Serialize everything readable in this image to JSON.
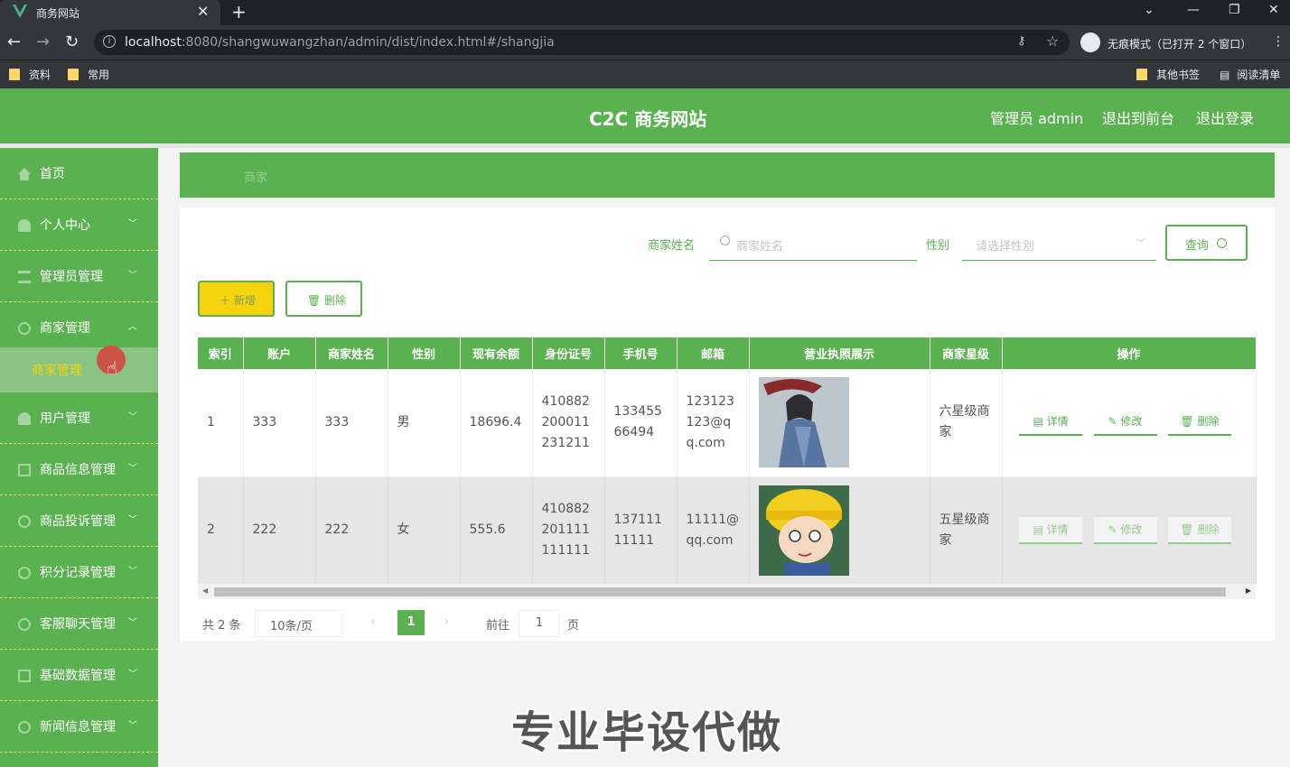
{
  "browser": {
    "tab_title": "商务网站",
    "tab_close": "✕",
    "new_tab": "+",
    "url_host": "localhost",
    "url_rest": ":8080/shangwuwangzhan/admin/dist/index.html#/shangjia",
    "incognito_label": "无痕模式（已打开 2 个窗口）",
    "bookmarks": [
      "资料",
      "常用"
    ],
    "other_bookmarks": "其他书签",
    "reading_list": "阅读清单"
  },
  "header": {
    "brand": "C2C 商务网站",
    "admin_label": "管理员 admin",
    "to_front": "退出到前台",
    "logout": "退出登录"
  },
  "sidebar": {
    "items": [
      {
        "label": "首页",
        "icon": "home-icon",
        "expandable": false
      },
      {
        "label": "个人中心",
        "icon": "user-icon",
        "expandable": true
      },
      {
        "label": "管理员管理",
        "icon": "menu-icon",
        "expandable": true
      },
      {
        "label": "商家管理",
        "icon": "store-icon",
        "expandable": true,
        "expanded": true
      },
      {
        "label": "用户管理",
        "icon": "users-icon",
        "expandable": true
      },
      {
        "label": "商品信息管理",
        "icon": "grid-icon",
        "expandable": true
      },
      {
        "label": "商品投诉管理",
        "icon": "complaint-icon",
        "expandable": true
      },
      {
        "label": "积分记录管理",
        "icon": "points-icon",
        "expandable": true
      },
      {
        "label": "客服聊天管理",
        "icon": "chat-icon",
        "expandable": true
      },
      {
        "label": "基础数据管理",
        "icon": "data-icon",
        "expandable": true
      },
      {
        "label": "新闻信息管理",
        "icon": "news-icon",
        "expandable": true
      }
    ],
    "active_sub": "商家管理"
  },
  "breadcrumb": "商家",
  "search": {
    "name_label": "商家姓名",
    "name_placeholder": "商家姓名",
    "gender_label": "性别",
    "gender_placeholder": "请选择性别",
    "query_button": "查询"
  },
  "actions": {
    "add": "＋ 新增",
    "delete": "🗑 删除"
  },
  "table": {
    "columns": [
      "索引",
      "账户",
      "商家姓名",
      "性别",
      "现有余额",
      "身份证号",
      "手机号",
      "邮箱",
      "营业执照展示",
      "商家星级",
      "操作"
    ],
    "rows": [
      {
        "index": "1",
        "account": "333",
        "name": "333",
        "gender": "男",
        "balance": "18696.4",
        "id_card": "410882200011231211",
        "phone": "13345566494",
        "email": "123123123@qq.com",
        "star": "六星级商家"
      },
      {
        "index": "2",
        "account": "222",
        "name": "222",
        "gender": "女",
        "balance": "555.6",
        "id_card": "410882201111111111",
        "phone": "13711111111",
        "email": "11111@qq.com",
        "star": "五星级商家"
      }
    ],
    "op_detail": "详情",
    "op_edit": "修改",
    "op_delete": "删除"
  },
  "pagination": {
    "total": "共 2 条",
    "page_size": "10条/页",
    "current": "1",
    "goto_label": "前往",
    "goto_value": "1",
    "page_suffix": "页"
  },
  "watermark": "专业毕设代做",
  "colors": {
    "primary": "#59b24f",
    "accent": "#f5d40f"
  }
}
